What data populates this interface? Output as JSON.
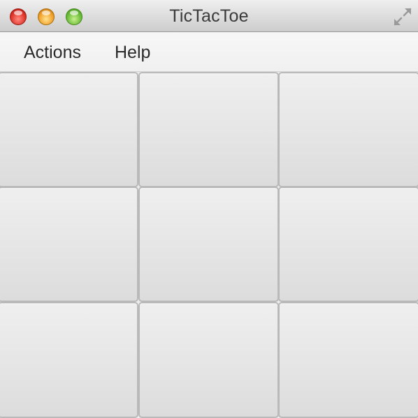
{
  "window": {
    "title": "TicTacToe",
    "controls": [
      "close",
      "minimize",
      "zoom"
    ],
    "fullscreen_icon": "fullscreen-arrows-icon"
  },
  "menubar": {
    "items": [
      {
        "label": "Actions"
      },
      {
        "label": "Help"
      }
    ]
  },
  "board": {
    "rows": [
      [
        "",
        "",
        ""
      ],
      [
        "",
        "",
        ""
      ],
      [
        "",
        "",
        ""
      ]
    ]
  }
}
